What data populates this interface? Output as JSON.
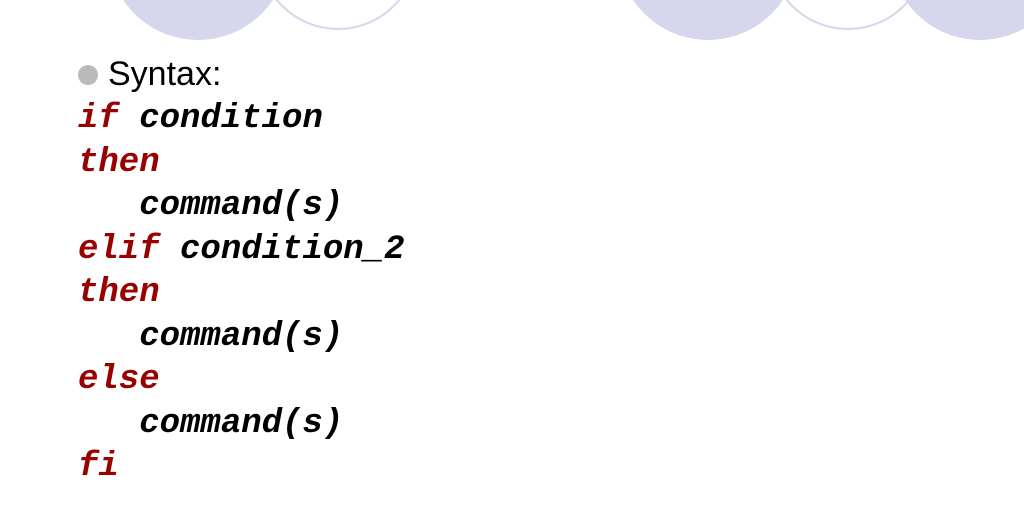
{
  "bullet_label": "Syntax:",
  "code": {
    "line1": {
      "keyword": "if ",
      "text": "condition"
    },
    "line2": {
      "keyword": "then"
    },
    "line3": {
      "text": "   command(s)"
    },
    "line4": {
      "keyword": "elif ",
      "text": "condition_2"
    },
    "line5": {
      "keyword": "then"
    },
    "line6": {
      "text": "   command(s)"
    },
    "line7": {
      "keyword": "else"
    },
    "line8": {
      "text": "   command(s)"
    },
    "line9": {
      "keyword": "fi"
    }
  }
}
